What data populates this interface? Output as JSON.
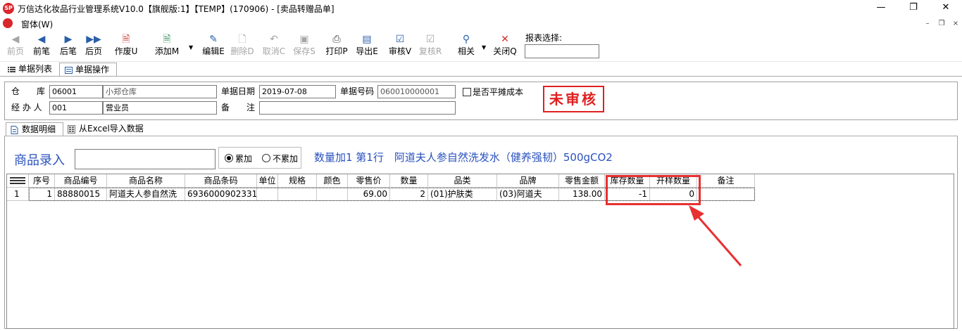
{
  "window": {
    "title": "万信达化妆品行业管理系统V10.0【旗舰版:1】【TEMP】(170906) - [卖品转赠品单]",
    "logo_text": "SP",
    "minimize": "—",
    "maximize": "❐",
    "close": "✕"
  },
  "menubar": {
    "item": "窗体(W)",
    "mdi_min": "–",
    "mdi_restore": "❐",
    "mdi_close": "×"
  },
  "toolbar": {
    "buttons": [
      {
        "label": "前页",
        "icon": "first-page-icon",
        "glyph": "◀",
        "enabled": false
      },
      {
        "label": "前笔",
        "icon": "prev-record-icon",
        "glyph": "◀",
        "enabled": true
      },
      {
        "label": "后笔",
        "icon": "next-record-icon",
        "glyph": "▶",
        "enabled": true
      },
      {
        "label": "后页",
        "icon": "last-page-icon",
        "glyph": "▶▶",
        "enabled": true
      },
      {
        "label": "作废U",
        "icon": "void-doc-icon",
        "glyph": "🗎",
        "enabled": true
      },
      {
        "label": "添加M",
        "icon": "add-doc-icon",
        "glyph": "🗎",
        "enabled": true
      },
      {
        "label": "编辑E",
        "icon": "edit-icon",
        "glyph": "✎",
        "enabled": true
      },
      {
        "label": "删除D",
        "icon": "delete-icon",
        "glyph": "🗋",
        "enabled": false
      },
      {
        "label": "取消C",
        "icon": "undo-icon",
        "glyph": "↶",
        "enabled": false
      },
      {
        "label": "保存S",
        "icon": "save-icon",
        "glyph": "▣",
        "enabled": false
      },
      {
        "label": "打印P",
        "icon": "print-icon",
        "glyph": "⎙",
        "enabled": true
      },
      {
        "label": "导出E",
        "icon": "export-icon",
        "glyph": "▤",
        "enabled": true
      },
      {
        "label": "审核V",
        "icon": "approve-icon",
        "glyph": "☑",
        "enabled": true
      },
      {
        "label": "复核R",
        "icon": "recheck-icon",
        "glyph": "☑",
        "enabled": false
      },
      {
        "label": "相关",
        "icon": "link-icon",
        "glyph": "⚲",
        "enabled": true
      },
      {
        "label": "关闭Q",
        "icon": "close-x-icon",
        "glyph": "✕",
        "enabled": true
      }
    ],
    "dropdown_glyph": "▼",
    "report_label": "报表选择:",
    "report_value": ""
  },
  "main_tabs": [
    {
      "label": "单据列表",
      "icon": "list-icon",
      "active": false
    },
    {
      "label": "单据操作",
      "icon": "form-icon",
      "active": true
    }
  ],
  "header_form": {
    "warehouse_label": "仓　　库",
    "warehouse_code": "06001",
    "warehouse_name": "小郑仓库",
    "date_label": "单据日期",
    "date_value": "2019-07-08",
    "number_label": "单据号码",
    "number_value": "060010000001",
    "cost_share_label": "是否平摊成本",
    "cost_share_checked": false,
    "handler_label": "经 办 人",
    "handler_code": "001",
    "handler_name": "营业员",
    "remark_label": "备　　注",
    "remark_value": "",
    "status_stamp": "未审核"
  },
  "detail_tabs": [
    {
      "label": "数据明细",
      "icon": "doc-icon",
      "active": true
    },
    {
      "label": "从Excel导入数据",
      "icon": "excel-icon",
      "active": false
    }
  ],
  "entry": {
    "label": "商品录入",
    "value": "",
    "radio_accumulate": "累加",
    "radio_no_accumulate": "不累加",
    "accumulate_selected": true,
    "info_line": "数量加1 第1行　阿道夫人参自然洗发水（健养强韧）500gCO2"
  },
  "grid": {
    "columns": [
      "序号",
      "商品编号",
      "商品名称",
      "商品条码",
      "单位",
      "规格",
      "颜色",
      "零售价",
      "数量",
      "品类",
      "品牌",
      "零售金额",
      "库存数量",
      "开样数量",
      "备注"
    ],
    "rows": [
      {
        "row_no": "1",
        "seq": "1",
        "code": "88880015",
        "name": "阿道夫人参自然洗",
        "barcode": "6936000902331",
        "unit": "",
        "spec": "",
        "color": "",
        "retail_price": "69.00",
        "qty": "2",
        "category": "(01)护肤类",
        "brand": "(03)阿道夫",
        "retail_amount": "138.00",
        "stock_qty": "-1",
        "sample_qty": "0",
        "remark": ""
      }
    ]
  },
  "colors": {
    "accent_blue": "#2a52be",
    "stamp_red": "#e02020",
    "highlight_red": "#e83030"
  }
}
